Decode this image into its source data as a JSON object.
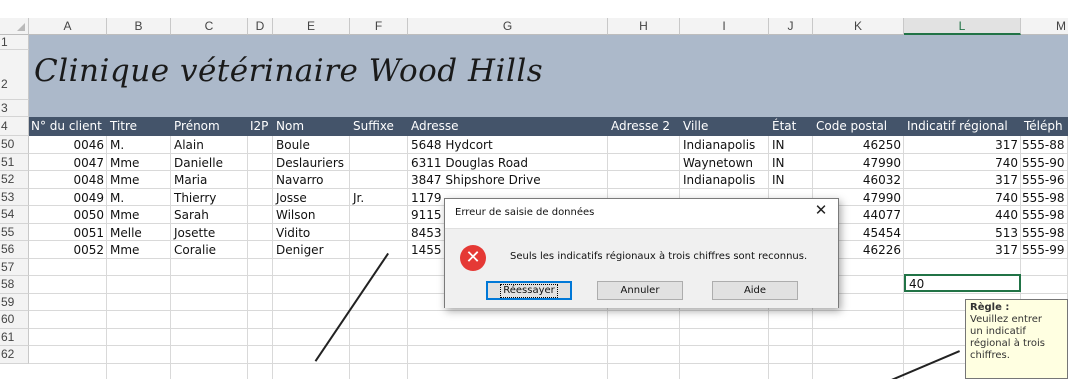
{
  "columns": [
    "A",
    "B",
    "C",
    "D",
    "E",
    "F",
    "G",
    "H",
    "I",
    "J",
    "K",
    "L",
    "M"
  ],
  "selected_column": "L",
  "row_numbers_top": [
    "1",
    "2",
    "3",
    "4"
  ],
  "title": "Clinique vétérinaire Wood Hills",
  "headers": {
    "A": "N° du client",
    "B": "Titre",
    "C": "Prénom",
    "D": "I2P",
    "E": "Nom",
    "F": "Suffixe",
    "G": "Adresse",
    "H": "Adresse 2",
    "I": "Ville",
    "J": "État",
    "K": "Code postal",
    "L": "Indicatif régional",
    "M": "Téléph"
  },
  "rows": [
    {
      "num": "50",
      "A": "0046",
      "B": "M.",
      "C": "Alain",
      "E": "Boule",
      "F": "",
      "G": "5648 Hydcort",
      "I": "Indianapolis",
      "J": "IN",
      "K": "46250",
      "L": "317",
      "M": "555-88"
    },
    {
      "num": "51",
      "A": "0047",
      "B": "Mme",
      "C": "Danielle",
      "E": "Deslauriers",
      "F": "",
      "G": "6311 Douglas Road",
      "I": "Waynetown",
      "J": "IN",
      "K": "47990",
      "L": "740",
      "M": "555-90"
    },
    {
      "num": "52",
      "A": "0048",
      "B": "Mme",
      "C": "Maria",
      "E": "Navarro",
      "F": "",
      "G": "3847 Shipshore Drive",
      "I": "Indianapolis",
      "J": "IN",
      "K": "46032",
      "L": "317",
      "M": "555-96"
    },
    {
      "num": "53",
      "A": "0049",
      "B": "M.",
      "C": "Thierry",
      "E": "Josse",
      "F": "Jr.",
      "G": "1179",
      "I": "",
      "J": "",
      "K": "47990",
      "L": "740",
      "M": "555-98"
    },
    {
      "num": "54",
      "A": "0050",
      "B": "Mme",
      "C": "Sarah",
      "E": "Wilson",
      "F": "",
      "G": "9115",
      "I": "",
      "J": "",
      "K": "44077",
      "L": "440",
      "M": "555-98"
    },
    {
      "num": "55",
      "A": "0051",
      "B": "Melle",
      "C": "Josette",
      "E": "Vidito",
      "F": "",
      "G": "8453",
      "I": "",
      "J": "",
      "K": "45454",
      "L": "513",
      "M": "555-98"
    },
    {
      "num": "56",
      "A": "0052",
      "B": "Mme",
      "C": "Coralie",
      "E": "Deniger",
      "F": "",
      "G": "1455",
      "I": "",
      "J": "",
      "K": "46226",
      "L": "317",
      "M": "555-99"
    }
  ],
  "empty_rows": [
    "57",
    "58",
    "59",
    "60",
    "61",
    "62"
  ],
  "editing_value": "40",
  "dialog": {
    "title": "Erreur de saisie de données",
    "message": "Seuls les indicatifs régionaux à trois chiffres sont reconnus.",
    "retry": "Réessayer",
    "cancel": "Annuler",
    "help": "Aide",
    "close": "✕"
  },
  "tooltip": {
    "title": "Règle :",
    "lines": [
      "Veuillez entrer",
      "un indicatif",
      "régional à trois",
      "chiffres."
    ]
  },
  "colors": {
    "band": "#acb9ca",
    "error": "#e53935",
    "selection": "#217346"
  }
}
